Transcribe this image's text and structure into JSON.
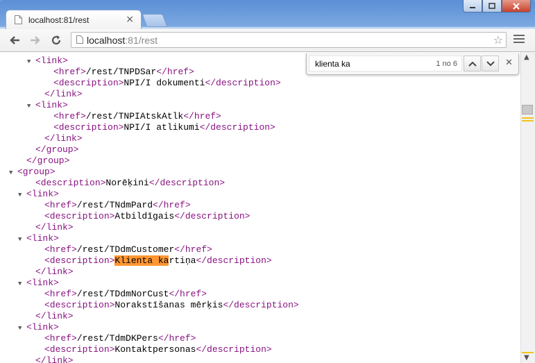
{
  "tab": {
    "title": "localhost:81/rest",
    "close": "×"
  },
  "omnibox": {
    "host": "localhost",
    "path": ":81/rest"
  },
  "find": {
    "query": "klienta ka",
    "count": "1 no 6"
  },
  "xml_lines": [
    {
      "indent": 3,
      "toggle": true,
      "parts": [
        [
          "tag",
          "<link>"
        ]
      ]
    },
    {
      "indent": 5,
      "parts": [
        [
          "tag",
          "<href>"
        ],
        [
          "txt",
          "/rest/TNPDSar"
        ],
        [
          "tag",
          "</href>"
        ]
      ]
    },
    {
      "indent": 5,
      "parts": [
        [
          "tag",
          "<description>"
        ],
        [
          "txt",
          "NPI/I dokumenti"
        ],
        [
          "tag",
          "</description>"
        ]
      ]
    },
    {
      "indent": 4,
      "parts": [
        [
          "tag",
          "</link>"
        ]
      ]
    },
    {
      "indent": 3,
      "toggle": true,
      "parts": [
        [
          "tag",
          "<link>"
        ]
      ]
    },
    {
      "indent": 5,
      "parts": [
        [
          "tag",
          "<href>"
        ],
        [
          "txt",
          "/rest/TNPIAtskAtlk"
        ],
        [
          "tag",
          "</href>"
        ]
      ]
    },
    {
      "indent": 5,
      "parts": [
        [
          "tag",
          "<description>"
        ],
        [
          "txt",
          "NPI/I atlikumi"
        ],
        [
          "tag",
          "</description>"
        ]
      ]
    },
    {
      "indent": 4,
      "parts": [
        [
          "tag",
          "</link>"
        ]
      ]
    },
    {
      "indent": 3,
      "parts": [
        [
          "tag",
          "</group>"
        ]
      ]
    },
    {
      "indent": 2,
      "parts": [
        [
          "tag",
          "</group>"
        ]
      ]
    },
    {
      "indent": 1,
      "toggle": true,
      "parts": [
        [
          "tag",
          "<group>"
        ]
      ]
    },
    {
      "indent": 3,
      "parts": [
        [
          "tag",
          "<description>"
        ],
        [
          "txt",
          "Norēķini"
        ],
        [
          "tag",
          "</description>"
        ]
      ]
    },
    {
      "indent": 2,
      "toggle": true,
      "parts": [
        [
          "tag",
          "<link>"
        ]
      ]
    },
    {
      "indent": 4,
      "parts": [
        [
          "tag",
          "<href>"
        ],
        [
          "txt",
          "/rest/TNdmPard"
        ],
        [
          "tag",
          "</href>"
        ]
      ]
    },
    {
      "indent": 4,
      "parts": [
        [
          "tag",
          "<description>"
        ],
        [
          "txt",
          "Atbildīgais"
        ],
        [
          "tag",
          "</description>"
        ]
      ]
    },
    {
      "indent": 3,
      "parts": [
        [
          "tag",
          "</link>"
        ]
      ]
    },
    {
      "indent": 2,
      "toggle": true,
      "parts": [
        [
          "tag",
          "<link>"
        ]
      ]
    },
    {
      "indent": 4,
      "parts": [
        [
          "tag",
          "<href>"
        ],
        [
          "txt",
          "/rest/TDdmCustomer"
        ],
        [
          "tag",
          "</href>"
        ]
      ]
    },
    {
      "indent": 4,
      "parts": [
        [
          "tag",
          "<description>"
        ],
        [
          "hl",
          "Klienta ka"
        ],
        [
          "txt",
          "rtiņa"
        ],
        [
          "tag",
          "</description>"
        ]
      ]
    },
    {
      "indent": 3,
      "parts": [
        [
          "tag",
          "</link>"
        ]
      ]
    },
    {
      "indent": 2,
      "toggle": true,
      "parts": [
        [
          "tag",
          "<link>"
        ]
      ]
    },
    {
      "indent": 4,
      "parts": [
        [
          "tag",
          "<href>"
        ],
        [
          "txt",
          "/rest/TDdmNorCust"
        ],
        [
          "tag",
          "</href>"
        ]
      ]
    },
    {
      "indent": 4,
      "parts": [
        [
          "tag",
          "<description>"
        ],
        [
          "txt",
          "Norakstīšanas mērķis"
        ],
        [
          "tag",
          "</description>"
        ]
      ]
    },
    {
      "indent": 3,
      "parts": [
        [
          "tag",
          "</link>"
        ]
      ]
    },
    {
      "indent": 2,
      "toggle": true,
      "parts": [
        [
          "tag",
          "<link>"
        ]
      ]
    },
    {
      "indent": 4,
      "parts": [
        [
          "tag",
          "<href>"
        ],
        [
          "txt",
          "/rest/TdmDKPers"
        ],
        [
          "tag",
          "</href>"
        ]
      ]
    },
    {
      "indent": 4,
      "parts": [
        [
          "tag",
          "<description>"
        ],
        [
          "txt",
          "Kontaktpersonas"
        ],
        [
          "tag",
          "</description>"
        ]
      ]
    },
    {
      "indent": 3,
      "parts": [
        [
          "tag",
          "</link>"
        ]
      ]
    }
  ]
}
